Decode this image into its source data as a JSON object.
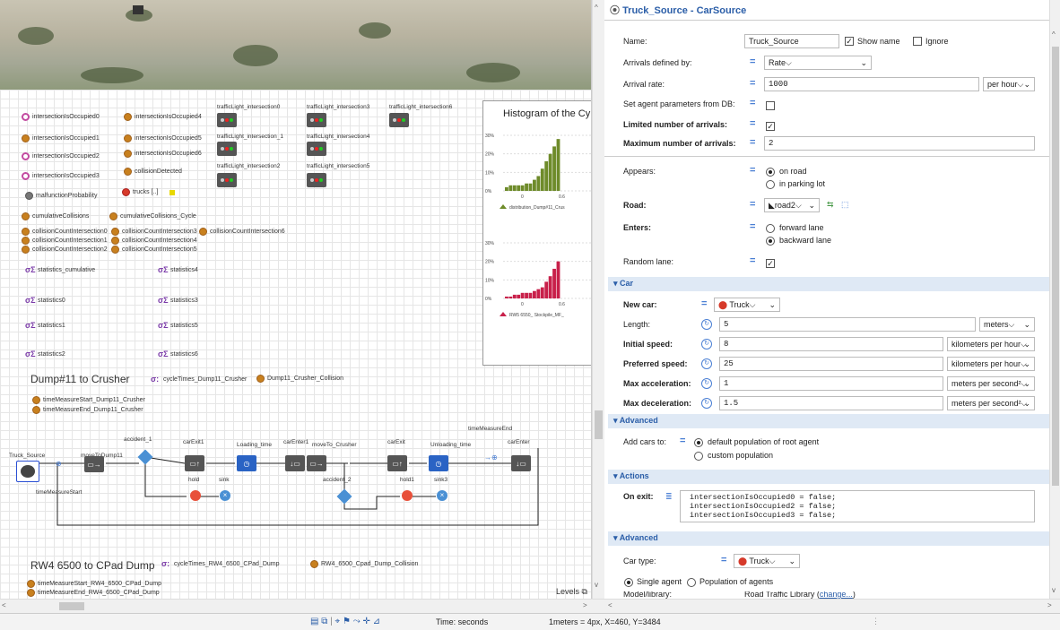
{
  "canvas": {
    "vars_left": [
      {
        "label": "intersectionIsOccupied0",
        "ring": true
      },
      {
        "label": "intersectionIsOccupied1",
        "ring": false
      },
      {
        "label": "intersectionIsOccupied2",
        "ring": true
      },
      {
        "label": "intersectionIsOccupied3",
        "ring": true
      }
    ],
    "vars_mid": [
      "intersectionIsOccupied4",
      "intersectionIsOccupied5",
      "intersectionIsOccupied6",
      "collisionDetected"
    ],
    "malfunction": "malfunctionProbability",
    "trucks": "trucks [..]",
    "traffic_lights": [
      "trafficLight_intersection0",
      "trafficLight_intersection3",
      "trafficLight_intersection6",
      "trafficLight_intersection_1",
      "trafficLight_intersection4",
      "trafficLight_intersection2",
      "trafficLight_intersection5"
    ],
    "cumulative": [
      "cumulativeCollisions",
      "cumulativeCollisions_Cycle"
    ],
    "collision_counts": [
      "collisionCountIntersection0",
      "collisionCountIntersection3",
      "collisionCountIntersection6",
      "collisionCountIntersection1",
      "collisionCountIntersection4",
      "collisionCountIntersection2",
      "collisionCountIntersection5"
    ],
    "stats_left": [
      "statistics_cumulative",
      "statistics0",
      "statistics1",
      "statistics2"
    ],
    "stats_right": [
      "statistics4",
      "statistics3",
      "statistics5",
      "statistics6"
    ],
    "dump11": {
      "title": "Dump#11 to Crusher",
      "cycle": "cycleTimes_Dump11_Crusher",
      "collision": "Dump11_Crusher_Collision",
      "tms": "timeMeasureStart_Dump11_Crusher",
      "tme": "timeMeasureEnd_Dump11_Crusher"
    },
    "flow": {
      "truck_source": "Truck_Source",
      "moveToDump11": "moveToDump11",
      "accident_1": "accident_1",
      "carExit1": "carExit1",
      "loading_time": "Loading_time",
      "carEnter1": "carEnter1",
      "moveTo_Crusher": "moveTo_Crusher",
      "carExit": "carExit",
      "unloading_time": "Unloading_time",
      "carEnter": "carEnter",
      "timeMeasureEnd": "timeMeasureEnd",
      "timeMeasureStart": "timeMeasureStart",
      "hold": "hold",
      "sink": "sink",
      "accident_2": "accident_2",
      "hold1": "hold1",
      "sink3": "sink3"
    },
    "rw4": {
      "title": "RW4 6500 to CPad Dump",
      "cycle": "cycleTimes_RW4_6500_CPad_Dump",
      "collision": "RW4_6500_Cpad_Dump_Collision",
      "tms": "timeMeasureStart_RW4_6500_CPad_Dump",
      "tme": "timeMeasureEnd_RW4_6500_CPad_Dump"
    },
    "levels": "Levels",
    "histogram": {
      "title": "Histogram of the Cy",
      "ticks1": [
        "30%",
        "20%",
        "10%",
        "0%"
      ],
      "xticks1": [
        "0",
        "0.6"
      ],
      "legend1": "distribution_Dump#11_Crus",
      "ticks2": [
        "30%",
        "20%",
        "10%",
        "0%"
      ],
      "xticks2": [
        "0",
        "0.6"
      ],
      "legend2": "RW5 6550_ Stockpile_MF_"
    }
  },
  "chart_data": [
    {
      "type": "bar",
      "title": "Histogram of the Cy",
      "series": [
        {
          "name": "distribution_Dump#11_Crus",
          "values": [
            0.02,
            0.03,
            0.03,
            0.03,
            0.03,
            0.04,
            0.04,
            0.06,
            0.08,
            0.12,
            0.16,
            0.2,
            0.24,
            0.28
          ]
        }
      ],
      "ylim": [
        0,
        0.3
      ],
      "color": "#6e8b2a"
    },
    {
      "type": "bar",
      "series": [
        {
          "name": "RW5 6550_ Stockpile_MF_",
          "values": [
            0.01,
            0.01,
            0.02,
            0.02,
            0.03,
            0.03,
            0.03,
            0.04,
            0.05,
            0.06,
            0.09,
            0.12,
            0.16,
            0.2
          ]
        }
      ],
      "ylim": [
        0,
        0.3
      ],
      "color": "#c8204a"
    }
  ],
  "props": {
    "header": "Truck_Source - CarSource",
    "name_label": "Name:",
    "name_value": "Truck_Source",
    "show_name": "Show name",
    "ignore": "Ignore",
    "arrivals_label": "Arrivals defined by:",
    "arrivals_value": "Rate",
    "rate_label": "Arrival rate:",
    "rate_value": "1000",
    "rate_unit": "per hour",
    "set_params": "Set agent parameters from DB:",
    "limited": "Limited number of arrivals:",
    "max_arrivals_label": "Maximum number of arrivals:",
    "max_arrivals_value": "2",
    "appears": "Appears:",
    "on_road": "on road",
    "in_parking": "in parking lot",
    "road_label": "Road:",
    "road_value": "road2",
    "enters": "Enters:",
    "forward": "forward lane",
    "backward": "backward lane",
    "random_lane": "Random lane:",
    "sec_car": "Car",
    "new_car_label": "New car:",
    "new_car_value": "Truck",
    "length_label": "Length:",
    "length_value": "5",
    "length_unit": "meters",
    "init_speed_label": "Initial speed:",
    "init_speed_value": "8",
    "init_speed_unit": "kilometers per hour",
    "pref_speed_label": "Preferred speed:",
    "pref_speed_value": "25",
    "pref_speed_unit": "kilometers per hour",
    "max_acc_label": "Max acceleration:",
    "max_acc_value": "1",
    "max_acc_unit": "meters per second²",
    "max_dec_label": "Max deceleration:",
    "max_dec_value": "1.5",
    "max_dec_unit": "meters per second²",
    "sec_adv": "Advanced",
    "add_cars_label": "Add cars to:",
    "default_pop": "default population of root agent",
    "custom_pop": "custom population",
    "sec_actions": "Actions",
    "on_exit_label": "On exit:",
    "code": [
      "intersectionIsOccupied0 = false;",
      "intersectionIsOccupied2 = false;",
      "intersectionIsOccupied3 = false;"
    ],
    "sec_adv2": "Advanced",
    "car_type_label": "Car type:",
    "car_type_value": "Truck",
    "single_agent": "Single agent",
    "pop_agents": "Population of agents",
    "model_lib": "Model/library:",
    "model_lib_value": "Road Traffic Library",
    "change": "change..."
  },
  "status": {
    "time": "Time: seconds",
    "scale": "1meters = 4px, X=460, Y=3484"
  }
}
